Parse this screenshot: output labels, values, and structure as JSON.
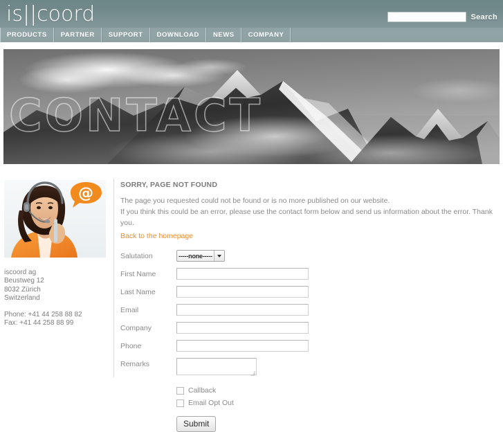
{
  "header": {
    "logo_text": "is||coord",
    "search": {
      "value": "",
      "placeholder": "",
      "button_label": "Search"
    }
  },
  "nav": {
    "items": [
      {
        "label": "PRODUCTS"
      },
      {
        "label": "PARTNER"
      },
      {
        "label": "SUPPORT"
      },
      {
        "label": "DOWNLOAD"
      },
      {
        "label": "NEWS"
      },
      {
        "label": "COMPANY"
      }
    ]
  },
  "banner": {
    "overlay_word": "CONTACT",
    "alt": "black-and-white photo of a snow-covered mountain peak with clouds"
  },
  "sidebar": {
    "photo_alt": "smiling female call-center agent with headset and orange @ speech bubble",
    "bubble_glyph": "@",
    "address": {
      "company": "iscoord ag",
      "street": "Beustweg 12",
      "city": "8032 Zürich",
      "country": "Switzerland",
      "phone": "Phone: +41 44 258 88 82",
      "fax": "Fax: +41 44 258 88 99"
    }
  },
  "content": {
    "error_title": "SORRY, PAGE NOT FOUND",
    "error_line1": "The page you requested could not be found or is no more published on our website.",
    "error_line2": "If you think this could be an error, please use the contact form below and send us information about the error. Thank you.",
    "home_link": "Back to the homepage"
  },
  "form": {
    "fields": [
      {
        "label": "Salutation",
        "type": "select",
        "value": "-----none-----"
      },
      {
        "label": "First Name",
        "type": "text",
        "value": "",
        "placeholder": ""
      },
      {
        "label": "Last Name",
        "type": "text",
        "value": "",
        "placeholder": ""
      },
      {
        "label": "Email",
        "type": "text",
        "value": "",
        "placeholder": ""
      },
      {
        "label": "Company",
        "type": "text",
        "value": "",
        "placeholder": ""
      },
      {
        "label": "Phone",
        "type": "text",
        "value": "",
        "placeholder": ""
      },
      {
        "label": "Remarks",
        "type": "textarea",
        "value": "",
        "placeholder": ""
      }
    ],
    "checkboxes": [
      {
        "label": "Callback",
        "checked": false
      },
      {
        "label": "Email Opt Out",
        "checked": false
      }
    ],
    "submit_label": "Submit"
  },
  "colors": {
    "header_bg": "#728b8d",
    "nav_bg": "#90a3a5",
    "link_orange": "#ef8c2a",
    "bubble_orange": "#f28b1e",
    "text_gray": "#8a8a8a"
  }
}
